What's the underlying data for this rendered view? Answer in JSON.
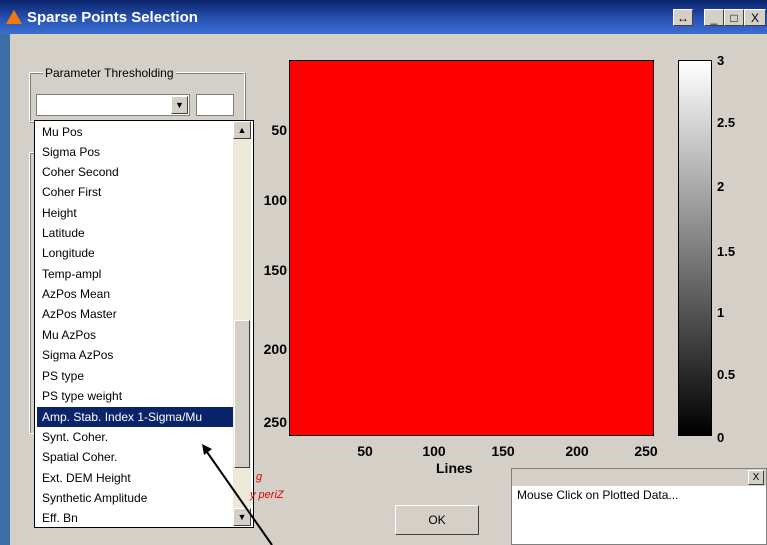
{
  "window": {
    "title": "Sparse Points Selection",
    "buttons": {
      "resize": "↔",
      "minimize": "_",
      "maximize": "□",
      "close": "X"
    }
  },
  "parameter_thresholding": {
    "legend": "Parameter Thresholding",
    "selected_value": "",
    "threshold_value": ""
  },
  "list": {
    "items": [
      "Mu Pos",
      "Sigma Pos",
      "Coher Second",
      "Coher First",
      "Height",
      "Latitude",
      "Longitude",
      "Temp-ampl",
      "AzPos Mean",
      "AzPos Master",
      "Mu AzPos",
      "Sigma AzPos",
      "PS type",
      "PS type weight",
      "Amp. Stab. Index 1-Sigma/Mu",
      "Synt. Coher.",
      "Spatial Coher.",
      "Ext. DEM Height",
      "Synthetic Amplitude",
      "Eff. Bn"
    ],
    "selected_index": 14
  },
  "partial_red_text": [
    "g",
    "y periZ"
  ],
  "plot": {
    "fill_color": "#ff0000",
    "y_ticks": [
      "50",
      "100",
      "150",
      "200",
      "250"
    ],
    "x_ticks": [
      "50",
      "100",
      "150",
      "200",
      "250"
    ],
    "xlabel": "Lines"
  },
  "colorbar": {
    "ticks": [
      "3",
      "2.5",
      "2",
      "1.5",
      "1",
      "0.5",
      "0"
    ]
  },
  "ok_button": "OK",
  "info_box": {
    "close": "X",
    "message": "Mouse Click on Plotted Data..."
  }
}
